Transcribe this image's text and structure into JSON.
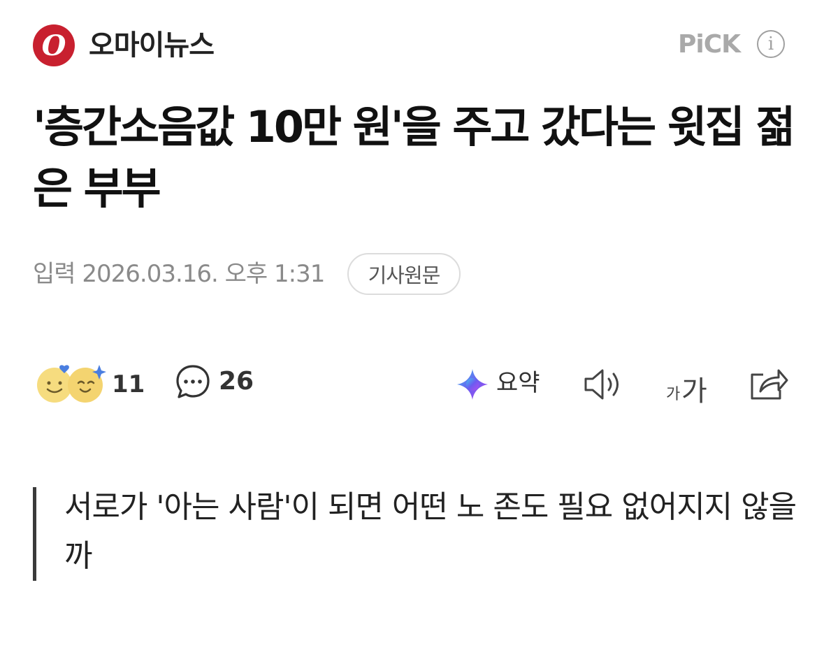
{
  "header": {
    "press_logo_letter": "O",
    "press_name": "오마이뉴스",
    "pick_label": "PiCK",
    "info_icon": "info-icon"
  },
  "article": {
    "title": "'층간소음값 10만 원'을 주고 갔다는 윗집 젊은 부부",
    "date_text": "입력 2026.03.16. 오후 1:31",
    "original_button_label": "기사원문"
  },
  "actions": {
    "reaction_count": "11",
    "comment_count": "26",
    "summary_label": "요약",
    "font_size_small": "가",
    "font_size_big": "가"
  },
  "quote": {
    "text": "서로가 '아는 사람'이 되면 어떤 노 존도 필요 없어지지 않을까"
  },
  "colors": {
    "brand": "#c8202f",
    "text_primary": "#111111",
    "text_meta": "#8a8a8a",
    "pick_gray": "#a9a9a9"
  }
}
